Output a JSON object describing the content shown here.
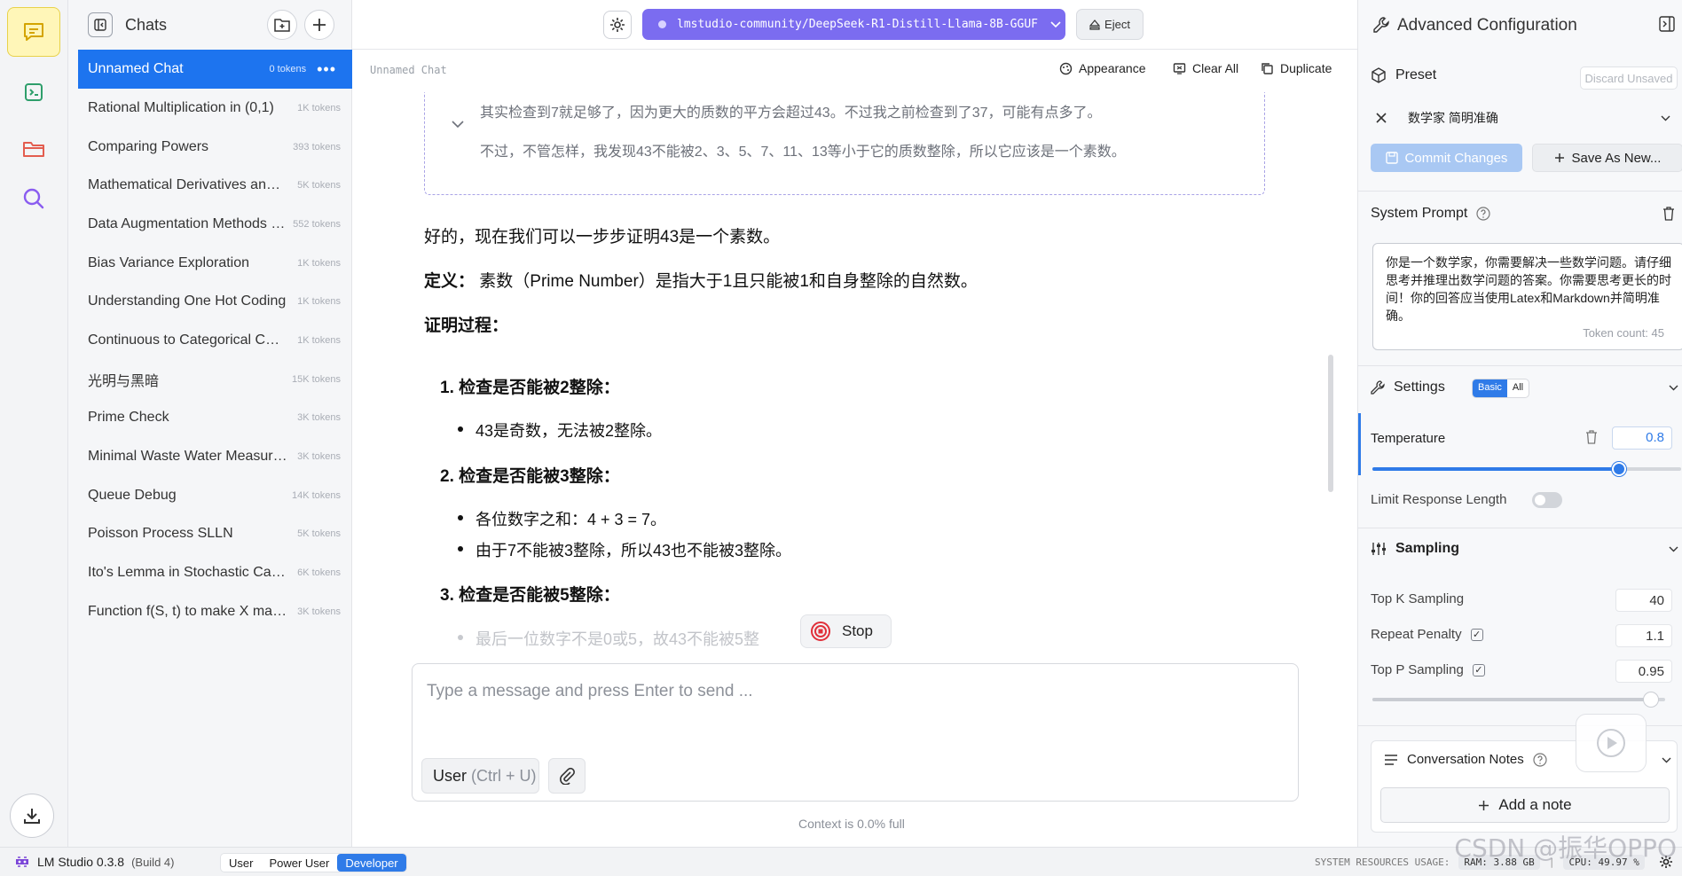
{
  "sidebar": {
    "title": "Chats",
    "items": [
      {
        "label": "Unnamed Chat",
        "tokens": "0 tokens",
        "active": true
      },
      {
        "label": "Rational Multiplication in (0,1)",
        "tokens": "1K tokens"
      },
      {
        "label": "Comparing Powers",
        "tokens": "393 tokens"
      },
      {
        "label": "Mathematical Derivatives and Applications",
        "tokens": "5K tokens"
      },
      {
        "label": "Data Augmentation Methods Overview",
        "tokens": "552 tokens"
      },
      {
        "label": "Bias Variance Exploration",
        "tokens": "1K tokens"
      },
      {
        "label": "Understanding One Hot Coding",
        "tokens": "1K tokens"
      },
      {
        "label": "Continuous to Categorical Conversion",
        "tokens": "1K tokens"
      },
      {
        "label": "光明与黑暗",
        "tokens": "15K tokens"
      },
      {
        "label": "Prime Check",
        "tokens": "3K tokens"
      },
      {
        "label": "Minimal Waste Water Measurement",
        "tokens": "3K tokens"
      },
      {
        "label": "Queue Debug",
        "tokens": "14K tokens"
      },
      {
        "label": "Poisson Process SLLN",
        "tokens": "5K tokens"
      },
      {
        "label": "Ito's Lemma in Stochastic Calculus",
        "tokens": "6K tokens"
      },
      {
        "label": "Function f(S, t) to make X martingale",
        "tokens": "3K tokens"
      }
    ]
  },
  "topbar": {
    "model": "lmstudio-community/DeepSeek-R1-Distill-Llama-8B-GGUF",
    "eject": "Eject"
  },
  "chatbar": {
    "chat_name": "Unnamed Chat",
    "appearance": "Appearance",
    "clear_all": "Clear All",
    "duplicate": "Duplicate"
  },
  "messages": {
    "think_line1": "其实检查到7就足够了，因为更大的质数的平方会超过43。不过我之前检查到了37，可能有点多了。",
    "think_line2": "不过，不管怎样，我发现43不能被2、3、5、7、11、13等小于它的质数整除，所以它应该是一个素数。",
    "intro": "好的，现在我们可以一步步证明43是一个素数。",
    "def_label": "定义：",
    "def_text": " 素数（Prime Number）是指大于1且只能被1和自身整除的自然数。",
    "proof_label": "证明过程：",
    "step1": "1. 检查是否能被2整除：",
    "step1_b1": "43是奇数，无法被2整除。",
    "step2": "2. 检查是否能被3整除：",
    "step2_b1": "各位数字之和：4 + 3 = 7。",
    "step2_b2": "由于7不能被3整除，所以43也不能被3整除。",
    "step3": "3. 检查是否能被5整除：",
    "step3_b1": "最后一位数字不是0或5，故43不能被5整",
    "stop": "Stop"
  },
  "composer": {
    "placeholder": "Type a message and press Enter to send ...",
    "role": "User",
    "role_shortcut": "(Ctrl + U)",
    "context": "Context is 0.0% full"
  },
  "config": {
    "title": "Advanced Configuration",
    "preset_label": "Preset",
    "discard": "Discard Unsaved",
    "preset_value": "数学家 简明准确",
    "commit": "Commit Changes",
    "save_as": "Save As New...",
    "system_prompt_label": "System Prompt",
    "system_prompt": "你是一个数学家，你需要解决一些数学问题。请仔细思考并推理出数学问题的答案。你需要思考更长的时间！你的回答应当使用Latex和Markdown并简明准确。",
    "token_count": "Token count: 45",
    "settings_label": "Settings",
    "seg_basic": "Basic",
    "seg_all": "All",
    "temperature_label": "Temperature",
    "temperature": "0.8",
    "temperature_fraction": 0.8,
    "limit_label": "Limit Response Length",
    "sampling_label": "Sampling",
    "topk_label": "Top K Sampling",
    "topk": "40",
    "repeat_label": "Repeat Penalty",
    "repeat": "1.1",
    "topp_label": "Top P Sampling",
    "topp": "0.95",
    "topp_fraction": 0.95,
    "notes_label": "Conversation Notes",
    "add_note": "Add a note"
  },
  "status": {
    "app": "LM Studio 0.3.8",
    "build": "(Build 4)",
    "modes": [
      "User",
      "Power User",
      "Developer"
    ],
    "active_mode": "Developer",
    "resources_label": "SYSTEM RESOURCES USAGE:",
    "ram": "RAM: 3.88 GB",
    "cpu": "CPU: 49.97 %"
  },
  "watermark": "CSDN @振华OPPO",
  "colors": {
    "accent": "#1d74ef",
    "model_pill": "#7b6cf0",
    "rail_active": "#fff6b8"
  }
}
